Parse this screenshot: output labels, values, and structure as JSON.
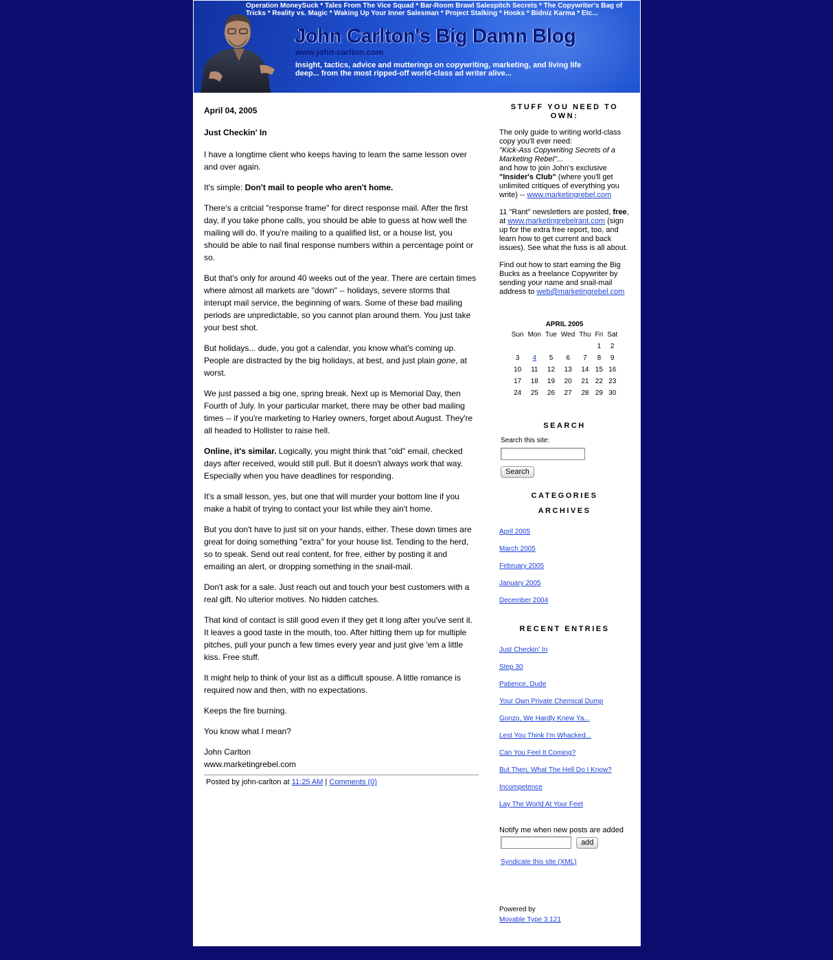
{
  "banner": {
    "topics": "Operation MoneySuck * Tales From The Vice Squad * Bar-Room Brawl Salespitch Secrets * The Copywriter's Bag of Tricks * Reality vs. Magic * Waking Up Your Inner Salesman * Project Stalking * Hooks * Bidniz Karma * Etc...",
    "title": "John Carlton's Big Damn Blog",
    "url": "www.john-carlton.com",
    "tagline": "Insight, tactics, advice and mutterings on copywriting, marketing, and living life deep... from the most ripped-off world-class ad writer alive..."
  },
  "post": {
    "date": "April 04, 2005",
    "title": "Just Checkin' In",
    "p1": "I have a longtime client who keeps having to learn the same lesson over and over again.",
    "p2_lead": "It's simple: ",
    "p2_bold": "Don't mail to people who aren't home.",
    "p3": "There's a critcial \"response frame\" for direct response mail. After the first day, if you take phone calls, you should be able to guess at how well the mailing will do. If you're mailing to a qualified list, or a house list, you should be able to nail final response numbers within a percentage point or so.",
    "p4": "But that's only for around 40 weeks out of the year. There are certain times where almost all markets are \"down\" -- holidays, severe storms that interupt mail service, the beginning of wars. Some of these bad mailing periods are unpredictable, so you cannot plan around them. You just take your best shot.",
    "p5_a": "But holidays... dude, you got a calendar, you know what's coming up. People are distracted by the big holidays, at best, and just plain ",
    "p5_em": "gone",
    "p5_b": ", at worst.",
    "p6": "We just passed a big one, spring break. Next up is Memorial Day, then Fourth of July. In your particular market, there may be other bad mailing times -- if you're marketing to Harley owners, forget about August. They're all headed to Hollister to raise hell.",
    "p7_bold": "Online, it's similar.",
    "p7": " Logically, you might think that \"old\" email, checked days after received, would still pull. But it doesn't always work that way. Especially when you have deadlines for responding.",
    "p8": "It's a small lesson, yes, but one that will murder your bottom line if you make a habit of trying to contact your list while they ain't home.",
    "p9": "But you don't have to just sit on your hands, either. These down times are great for doing something \"extra\" for your house list. Tending to the herd, so to speak. Send out real content, for free, either by posting it and emailing an alert, or dropping something in the snail-mail.",
    "p10": "Don't ask for a sale. Just reach out and touch your best customers with a real gift. No ulterior motives. No hidden catches.",
    "p11": "That kind of contact is still good even if they get it long after you've sent it. It leaves a good taste in the mouth, too. After hitting them up for multiple pitches, pull your punch a few times every year and just give 'em a little kiss. Free stuff.",
    "p12": "It might help to think of your list as a difficult spouse. A little romance is required now and then, with no expectations.",
    "p13": "Keeps the fire burning.",
    "p14": "You know what I mean?",
    "sig_name": "John Carlton",
    "sig_url": "www.marketingrebel.com",
    "posted_by": "Posted by john-carlton at ",
    "posted_time": "11:25 AM",
    "posted_sep": " | ",
    "comments": "Comments (0)"
  },
  "sidebar": {
    "stuff_head": "STUFF YOU NEED TO OWN:",
    "s1_a": "The only guide to writing world-class copy you'll ever need:",
    "s1_em": "\"Kick-Ass Copywriting Secrets of a Marketing Rebel\"",
    "s1_b": "...",
    "s1_c": "and how to join John's exclusive ",
    "s1_bold": "\"Insider's Club\"",
    "s1_d": " (where you'll get unlimited critiques of everything you write) -- ",
    "s1_link": "www.marketingrebel.com",
    "s2_a": "11 \"Rant\" newsletters are posted, ",
    "s2_bold": "free",
    "s2_b": ", at ",
    "s2_link": "www.marketingrebelrant.com",
    "s2_c": " (sign up for the extra free report, too, and learn how to get current and back issues). See what the fuss is all about.",
    "s3_a": "Find out how to start earning the Big Bucks as a freelance Copywriter by sending your name and snail-mail address to ",
    "s3_link": "web@marketingrebel.com",
    "calendar": {
      "caption": "APRIL 2005",
      "days": [
        "Sun",
        "Mon",
        "Tue",
        "Wed",
        "Thu",
        "Fri",
        "Sat"
      ],
      "weeks": [
        [
          "",
          "",
          "",
          "",
          "",
          "1",
          "2"
        ],
        [
          "3",
          "4",
          "5",
          "6",
          "7",
          "8",
          "9"
        ],
        [
          "10",
          "11",
          "12",
          "13",
          "14",
          "15",
          "16"
        ],
        [
          "17",
          "18",
          "19",
          "20",
          "21",
          "22",
          "23"
        ],
        [
          "24",
          "25",
          "26",
          "27",
          "28",
          "29",
          "30"
        ]
      ],
      "linked_day": "4"
    },
    "search_head": "SEARCH",
    "search_label": "Search this site:",
    "search_button": "Search",
    "categories_head": "CATEGORIES",
    "archives_head": "ARCHIVES",
    "archives": [
      "April 2005",
      "March 2005",
      "February 2005",
      "January 2005",
      "December 2004"
    ],
    "recent_head": "RECENT ENTRIES",
    "recent": [
      "Just Checkin' In",
      "Step 30",
      "Patience, Dude",
      "Your Own Private Chemical Dump",
      "Gonzo, We Hardly Knew Ya...",
      "Lest You Think I'm Whacked...",
      "Can You Feel It Coming?",
      "But Then, What The Hell Do I Know?",
      "Incompetence",
      "Lay The World At Your Feet"
    ],
    "notify_label": "Notify me when new posts are added",
    "add_button": "add",
    "syndicate": "Syndicate this site (XML)",
    "powered": "Powered by",
    "powered_link": "Movable Type 3.121"
  }
}
